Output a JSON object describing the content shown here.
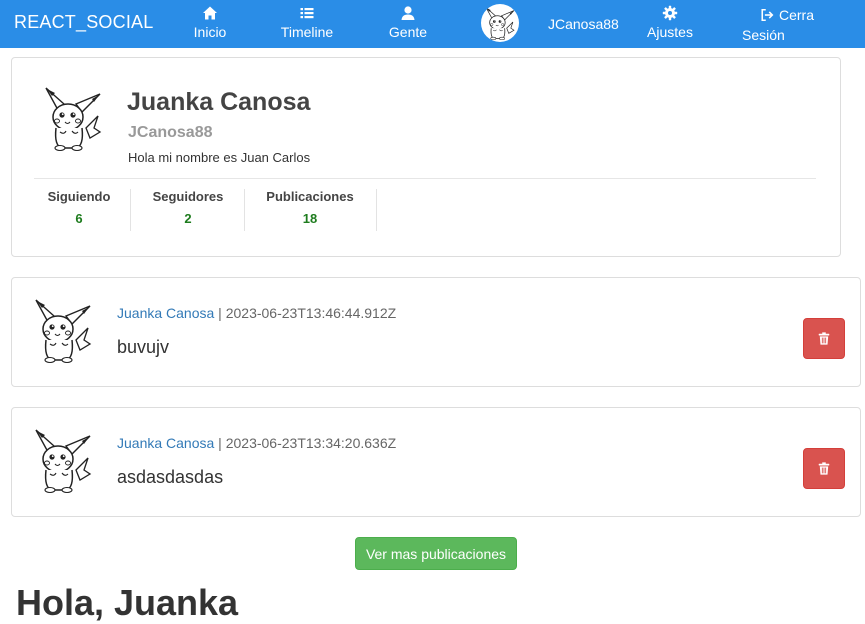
{
  "navbar": {
    "brand": "REACT_SOCIAL",
    "items": [
      {
        "label": "Inicio",
        "icon": "home-icon"
      },
      {
        "label": "Timeline",
        "icon": "list-icon"
      },
      {
        "label": "Gente",
        "icon": "user-icon"
      },
      {
        "label": "Ajustes",
        "icon": "gear-icon"
      }
    ],
    "username": "JCanosa88",
    "logout_line1": "Cerra",
    "logout_line2": "Sesión",
    "color": "#2a8de7"
  },
  "profile": {
    "name": "Juanka Canosa",
    "nick": "JCanosa88",
    "bio": "Hola mi nombre es Juan Carlos",
    "stats": [
      {
        "label": "Siguiendo",
        "value": "6"
      },
      {
        "label": "Seguidores",
        "value": "2"
      },
      {
        "label": "Publicaciones",
        "value": "18"
      }
    ]
  },
  "publications": [
    {
      "author": "Juanka Canosa",
      "separator": " | ",
      "date": "2023-06-23T13:46:44.912Z",
      "text": "buvujv"
    },
    {
      "author": "Juanka Canosa",
      "separator": " | ",
      "date": "2023-06-23T13:34:20.636Z",
      "text": "asdasdasdas"
    }
  ],
  "more_button": "Ver mas publicaciones",
  "bottom_heading": "Hola, Juanka",
  "colors": {
    "delete": "#d9534f",
    "more": "#5cb85c",
    "stat_value": "#1e7c1e",
    "author_link": "#337ab7"
  }
}
